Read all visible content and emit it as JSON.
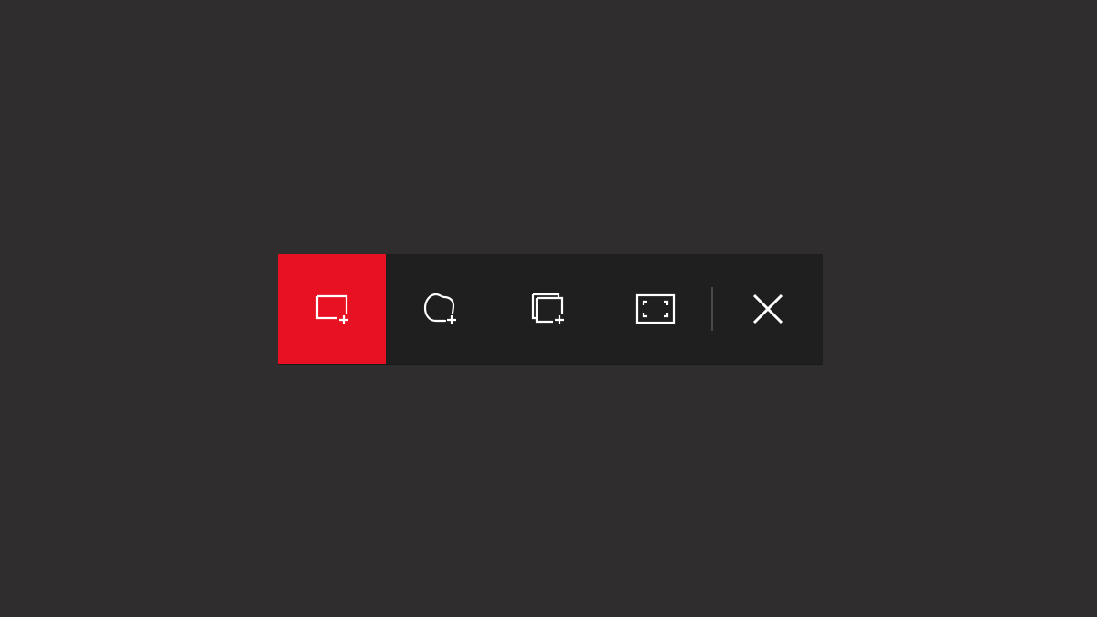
{
  "toolbar": {
    "buttons": [
      {
        "name": "rectangular-snip",
        "icon": "rectangle-snip-icon",
        "active": true
      },
      {
        "name": "freeform-snip",
        "icon": "freeform-snip-icon",
        "active": false
      },
      {
        "name": "window-snip",
        "icon": "window-snip-icon",
        "active": false
      },
      {
        "name": "fullscreen-snip",
        "icon": "fullscreen-snip-icon",
        "active": false
      }
    ],
    "close_icon": "close-icon"
  },
  "colors": {
    "background": "#2f2d2e",
    "toolbar": "#1f1f1f",
    "accent": "#e81123",
    "icon": "#ffffff"
  }
}
